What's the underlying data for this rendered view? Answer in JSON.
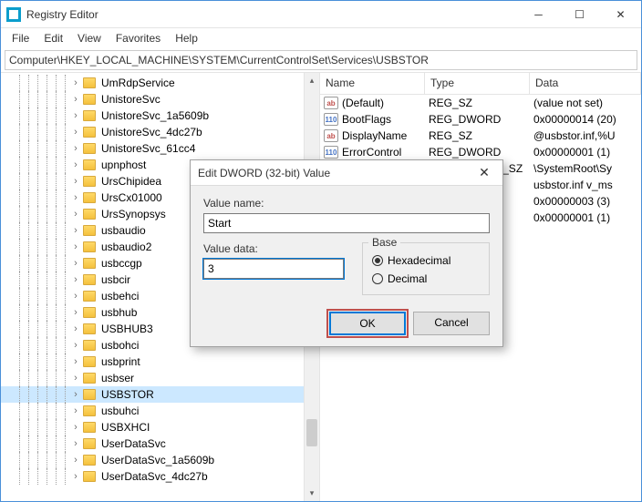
{
  "window": {
    "title": "Registry Editor"
  },
  "menu": {
    "file": "File",
    "edit": "Edit",
    "view": "View",
    "favorites": "Favorites",
    "help": "Help"
  },
  "address": "Computer\\HKEY_LOCAL_MACHINE\\SYSTEM\\CurrentControlSet\\Services\\USBSTOR",
  "tree": {
    "items": [
      {
        "label": "UmRdpService",
        "expandable": true
      },
      {
        "label": "UnistoreSvc",
        "expandable": true
      },
      {
        "label": "UnistoreSvc_1a5609b",
        "expandable": true
      },
      {
        "label": "UnistoreSvc_4dc27b",
        "expandable": true
      },
      {
        "label": "UnistoreSvc_61cc4",
        "expandable": true
      },
      {
        "label": "upnphost",
        "expandable": true
      },
      {
        "label": "UrsChipidea",
        "expandable": true
      },
      {
        "label": "UrsCx01000",
        "expandable": true
      },
      {
        "label": "UrsSynopsys",
        "expandable": true
      },
      {
        "label": "usbaudio",
        "expandable": true
      },
      {
        "label": "usbaudio2",
        "expandable": true
      },
      {
        "label": "usbccgp",
        "expandable": true
      },
      {
        "label": "usbcir",
        "expandable": true
      },
      {
        "label": "usbehci",
        "expandable": true
      },
      {
        "label": "usbhub",
        "expandable": true
      },
      {
        "label": "USBHUB3",
        "expandable": true
      },
      {
        "label": "usbohci",
        "expandable": true
      },
      {
        "label": "usbprint",
        "expandable": true
      },
      {
        "label": "usbser",
        "expandable": true
      },
      {
        "label": "USBSTOR",
        "expandable": true,
        "selected": true
      },
      {
        "label": "usbuhci",
        "expandable": true
      },
      {
        "label": "USBXHCI",
        "expandable": true
      },
      {
        "label": "UserDataSvc",
        "expandable": true
      },
      {
        "label": "UserDataSvc_1a5609b",
        "expandable": true
      },
      {
        "label": "UserDataSvc_4dc27b",
        "expandable": true
      }
    ]
  },
  "list": {
    "headers": {
      "name": "Name",
      "type": "Type",
      "data": "Data"
    },
    "rows": [
      {
        "icon": "sz",
        "name": "(Default)",
        "type": "REG_SZ",
        "data": "(value not set)"
      },
      {
        "icon": "dw",
        "name": "BootFlags",
        "type": "REG_DWORD",
        "data": "0x00000014 (20)"
      },
      {
        "icon": "sz",
        "name": "DisplayName",
        "type": "REG_SZ",
        "data": "@usbstor.inf,%U"
      },
      {
        "icon": "dw",
        "name": "ErrorControl",
        "type": "REG_DWORD",
        "data": "0x00000001 (1)"
      },
      {
        "icon": "sz",
        "name": " ",
        "type": "REG_EXPAND_SZ",
        "data": "\\SystemRoot\\Sy"
      },
      {
        "icon": "sz",
        "name": " ",
        "type": "_SZ",
        "data": "usbstor.inf v_ms"
      },
      {
        "icon": "dw",
        "name": " ",
        "type": "RD",
        "data": "0x00000003 (3)"
      },
      {
        "icon": "dw",
        "name": " ",
        "type": "RD",
        "data": "0x00000001 (1)"
      }
    ]
  },
  "dialog": {
    "title": "Edit DWORD (32-bit) Value",
    "value_name_label": "Value name:",
    "value_name": "Start",
    "value_data_label": "Value data:",
    "value_data": "3",
    "base_label": "Base",
    "hex_label": "Hexadecimal",
    "dec_label": "Decimal",
    "ok": "OK",
    "cancel": "Cancel"
  }
}
